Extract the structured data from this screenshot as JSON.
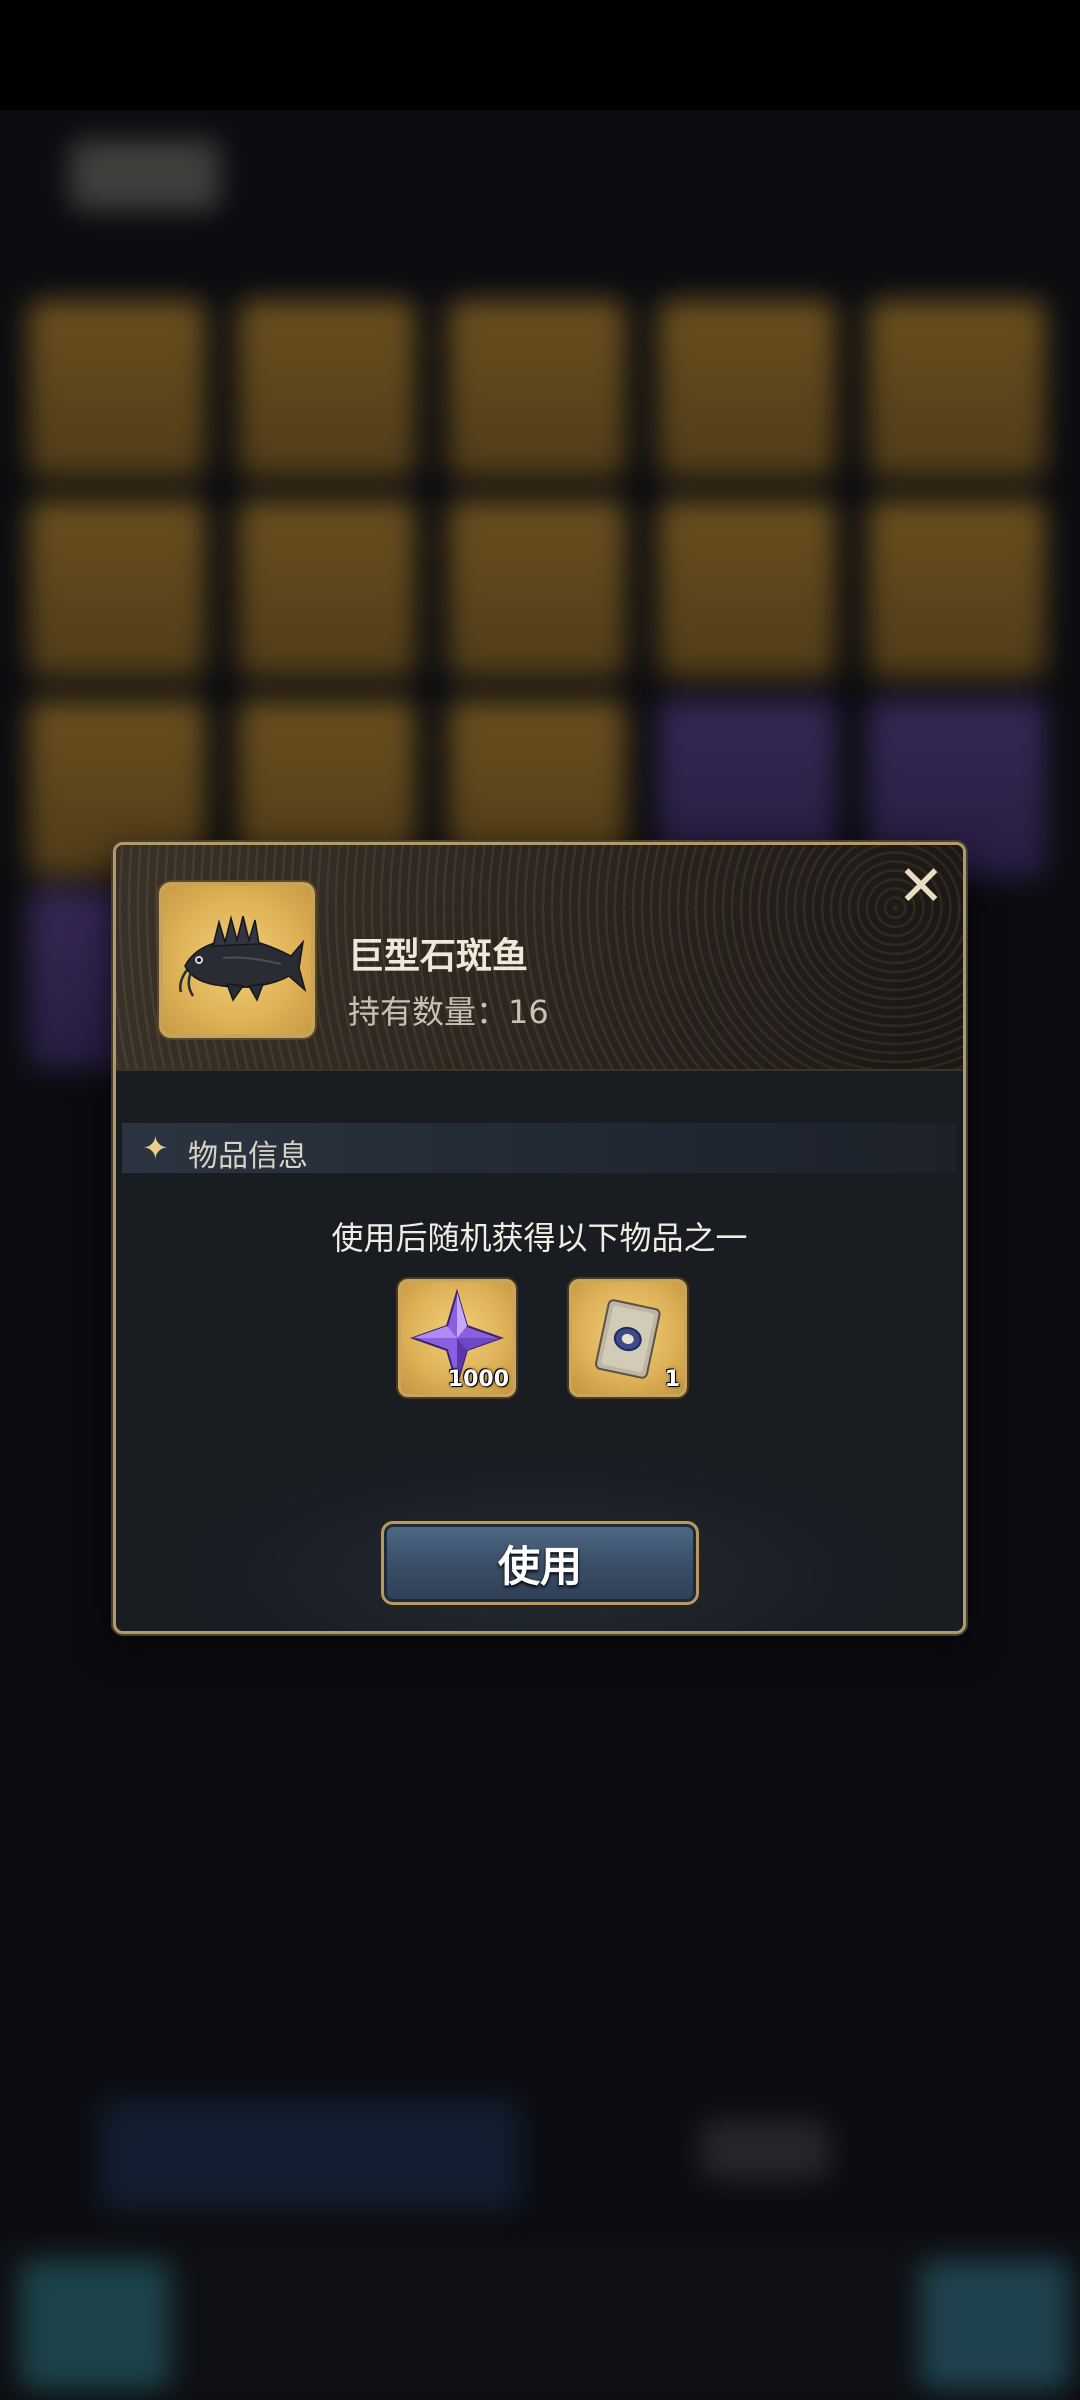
{
  "item": {
    "name": "巨型石斑鱼",
    "count_text": "持有数量：16",
    "icon": "grouper-fish-icon"
  },
  "section": {
    "title": "物品信息",
    "icon": "sparkle-star-icon"
  },
  "description": "使用后随机获得以下物品之一",
  "rewards": [
    {
      "icon": "purple-crystal-icon",
      "quantity": "1000"
    },
    {
      "icon": "card-ticket-icon",
      "quantity": "1"
    }
  ],
  "use_button_label": "使用",
  "close_icon": "close-x-icon",
  "colors": {
    "gold_border": "#b29a6a",
    "slot_gold": "#dcb057",
    "button_blue": "#3a4f68"
  }
}
